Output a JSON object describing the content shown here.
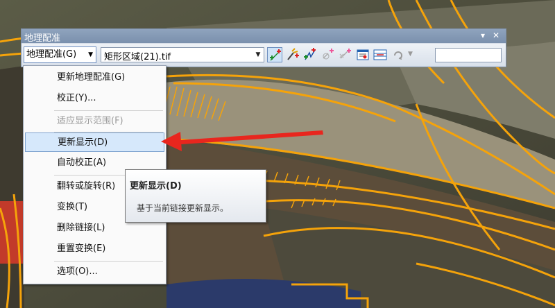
{
  "window": {
    "title": "地理配准"
  },
  "toolbar": {
    "georef_menu_label": "地理配准(G)",
    "layer_value": "矩形区域(21).tif",
    "tools": [
      "add-control-points-icon",
      "auto-match-icon",
      "add-control-points-link-icon",
      "view-link-table-icon",
      "select-link-icon",
      "delete-link-icon",
      "view-table-icon",
      "link-table-icon",
      "rotate-icon"
    ],
    "rms_value": ""
  },
  "menu": {
    "items": [
      {
        "label": "更新地理配准(G)",
        "enabled": true
      },
      {
        "label": "校正(Y)...",
        "enabled": true
      },
      {
        "label": "适应显示范围(F)",
        "enabled": false
      },
      {
        "label": "更新显示(D)",
        "enabled": true,
        "highlighted": true
      },
      {
        "label": "自动校正(A)",
        "enabled": true
      },
      {
        "label": "翻转或旋转(R)",
        "enabled": true
      },
      {
        "label": "变换(T)",
        "enabled": true
      },
      {
        "label": "删除链接(L)",
        "enabled": true
      },
      {
        "label": "重置变换(E)",
        "enabled": true
      },
      {
        "label": "选项(O)...",
        "enabled": true
      }
    ]
  },
  "tooltip": {
    "title": "更新显示(D)",
    "description": "基于当前链接更新显示。"
  },
  "colors": {
    "overlay_lines": "#f5a30a",
    "arrow": "#e8261e",
    "highlight": "#d6e8fb"
  }
}
